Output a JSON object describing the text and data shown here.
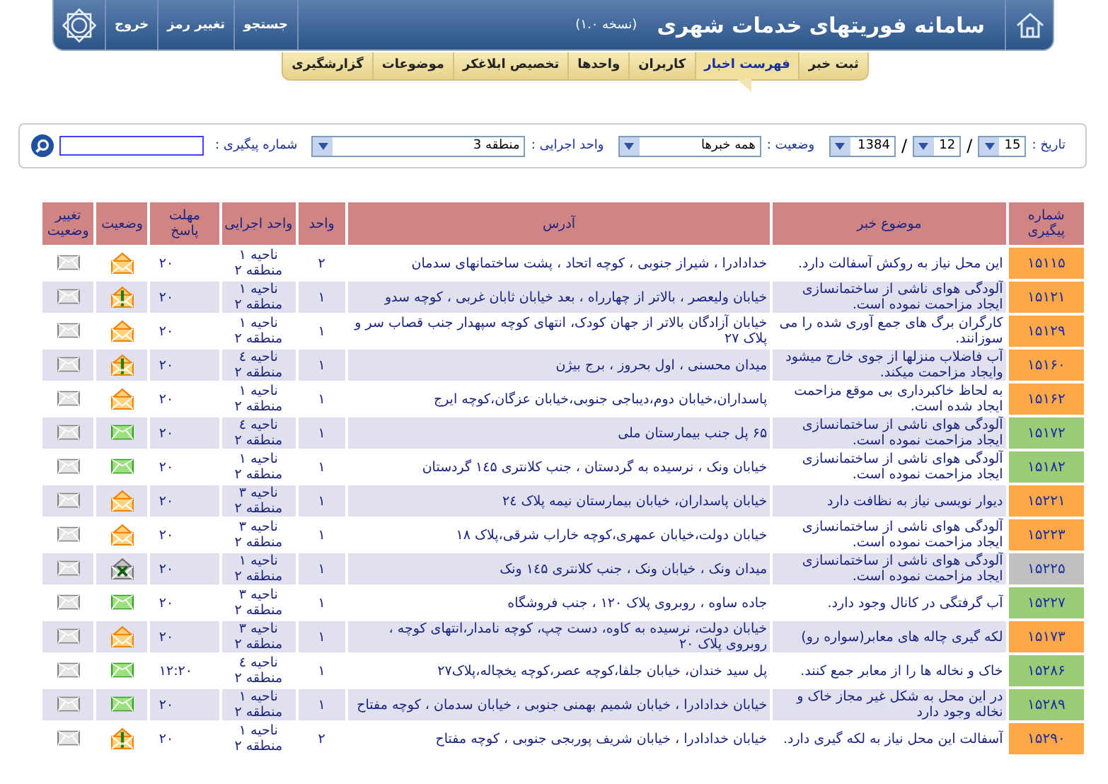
{
  "header": {
    "title": "سامانه فوریتهای خدمات شهری",
    "version": "(نسخه ۱.۰)",
    "links": [
      "جستجو",
      "تغییر رمز",
      "خروج"
    ]
  },
  "tabs": [
    {
      "label": "ثبت خبر",
      "selected": false
    },
    {
      "label": "فهرست اخبار",
      "selected": true
    },
    {
      "label": "کاربران",
      "selected": false
    },
    {
      "label": "واحدها",
      "selected": false
    },
    {
      "label": "تخصیص ابلاغکر",
      "selected": false
    },
    {
      "label": "موضوعات",
      "selected": false
    },
    {
      "label": "گزارشگیری",
      "selected": false
    }
  ],
  "filters": {
    "date_label": "تاریخ :",
    "day": "15",
    "month": "12",
    "year": "1384",
    "separator": "/",
    "status_label": "وضعیت :",
    "status_value": "همه خبرها",
    "unit_label": "واحد اجرایی :",
    "unit_value": "منطقه 3",
    "tracking_label": "شماره پیگیری :"
  },
  "table": {
    "columns": [
      "شماره پیگیری",
      "موضوع خبر",
      "آدرس",
      "واحد",
      "واحد اجرایی",
      "مهلت پاسخ",
      "وضعیت",
      "تغییر وضعیت"
    ],
    "rows": [
      {
        "number": "۱۵۱۱۵",
        "color": "#ffa84a",
        "subject": "این محل نیاز به روکش آسفالت دارد.",
        "address": "خدادادرا ، شیراز جنوبی ، کوچه اتحاد ، پشت ساختمانهای سدمان",
        "unit": "۲",
        "exec": "ناحیه ۱ منطقه ۲",
        "deadline": "۲۰",
        "kind": "open"
      },
      {
        "number": "۱۵۱۲۱",
        "color": "#ffa84a",
        "subject": "آلودگی هوای ناشی از ساختمانسازی ایجاد مزاحمت نموده است.",
        "address": "خیابان ولیعصر ، بالاتر از چهارراه ، بعد خیابان ثابان غربی ، کوچه سدو",
        "unit": "۱",
        "exec": "ناحیه ۱ منطقه ۲",
        "deadline": "۲۰",
        "kind": "alert"
      },
      {
        "number": "۱۵۱۲۹",
        "color": "#ffa84a",
        "subject": "کارگران برگ های جمع آوری شده را می سوزانند.",
        "address": "خیابان آزادگان بالاتر از جهان کودک، انتهای کوچه سپهدار جنب قصاب سر و پلاک ۲۷",
        "unit": "۱",
        "exec": "ناحیه ۱ منطقه ۲",
        "deadline": "۲۰",
        "kind": "open"
      },
      {
        "number": "۱۵۱۶۰",
        "color": "#ffa84a",
        "subject": "آب فاضلاب منزلها از جوی خارج میشود وایجاد مزاحمت میکند.",
        "address": "میدان محسنی ، اول بحروز ، برج بیژن",
        "unit": "۱",
        "exec": "ناحیه ٤ منطقه ۲",
        "deadline": "۲۰",
        "kind": "alert"
      },
      {
        "number": "۱۵۱۶۲",
        "color": "#ffa84a",
        "subject": "به لحاظ خاکبرداری بی موقع مزاحمت ایجاد شده است.",
        "address": "پاسداران،خیابان دوم،دیباجی جنوبی،خیابان عزگان،کوچه ایرج",
        "unit": "۱",
        "exec": "ناحیه ۱ منطقه ۲",
        "deadline": "۲۰",
        "kind": "open"
      },
      {
        "number": "۱۵۱۷۲",
        "color": "#99cc77",
        "subject": "آلودگی هوای ناشی از ساختمانسازی ایجاد مزاحمت نموده است.",
        "address": "۶۵ پل جنب بیمارستان ملی",
        "unit": "۱",
        "exec": "ناحیه ٤ منطقه ۲",
        "deadline": "۲۰",
        "kind": "done"
      },
      {
        "number": "۱۵۱۸۲",
        "color": "#99cc77",
        "subject": "آلودگی هوای ناشی از ساختمانسازی ایجاد مزاحمت نموده است.",
        "address": "خیابان ونک ، نرسیده به گردستان ، جنب کلانتری ۱٤۵ گردستان",
        "unit": "۱",
        "exec": "ناحیه ۱ منطقه ۲",
        "deadline": "۲۰",
        "kind": "done"
      },
      {
        "number": "۱۵۲۲۱",
        "color": "#ffa84a",
        "subject": "دیوار نویسی نیاز به نظافت دارد",
        "address": "خیابان پاسداران، خیابان بیمارستان نیمه پلاک ۲٤",
        "unit": "۱",
        "exec": "ناحیه ۳ منطقه ۲",
        "deadline": "۲۰",
        "kind": "open"
      },
      {
        "number": "۱۵۲۲۳",
        "color": "#ffa84a",
        "subject": "آلودگی هوای ناشی از ساختمانسازی ایجاد مزاحمت نموده است.",
        "address": "خیابان دولت،خیابان عمهری،کوچه خاراب شرقی،پلاک ۱۸",
        "unit": "۱",
        "exec": "ناحیه ۳ منطقه ۲",
        "deadline": "۲۰",
        "kind": "open"
      },
      {
        "number": "۱۵۲۲۵",
        "color": "#c0c0c0",
        "subject": "آلودگی هوای ناشی از ساختمانسازی ایجاد مزاحمت نموده است.",
        "address": "میدان ونک ، خیابان ونک ، جنب کلانتری ۱٤۵ ونک",
        "unit": "۱",
        "exec": "ناحیه ۱ منطقه ۲",
        "deadline": "۲۰",
        "kind": "cancelled"
      },
      {
        "number": "۱۵۲۲۷",
        "color": "#99cc77",
        "subject": "آب گرفتگی در کانال وجود دارد.",
        "address": "جاده ساوه ، روبروی پلاک ۱۲۰ ، جنب فروشگاه",
        "unit": "۱",
        "exec": "ناحیه ۳ منطقه ۲",
        "deadline": "۲۰",
        "kind": "done"
      },
      {
        "number": "۱۵۱۷۳",
        "color": "#ffa84a",
        "subject": "لکه گیری چاله های معابر(سواره رو)",
        "address": "خیابان دولت، نرسیده به کاوه، دست چپ، کوچه نامدار،انتهای کوچه ، روبروی پلاک ۲۰",
        "unit": "۱",
        "exec": "ناحیه ۳ منطقه ۲",
        "deadline": "۲۰",
        "kind": "open"
      },
      {
        "number": "۱۵۲۸۶",
        "color": "#99cc77",
        "subject": "خاک و نخاله ها را از معابر جمع کنند.",
        "address": "پل سید خندان، خیابان جلفا،کوچه عصر،کوچه یخچاله،پلاک۲۷",
        "unit": "۱",
        "exec": "ناحیه ٤ منطقه ۲",
        "deadline": "۱۲:۲۰",
        "kind": "done"
      },
      {
        "number": "۱۵۲۸۹",
        "color": "#99cc77",
        "subject": "در این محل به شکل غیر مجاز خاک و نخاله وجود دارد",
        "address": "خیابان خدادادرا ، خیابان شمیم بهمنی جنوبی ، خیابان سدمان ، کوچه مفتاح",
        "unit": "۱",
        "exec": "ناحیه ۱ منطقه ۲",
        "deadline": "۲۰",
        "kind": "done"
      },
      {
        "number": "۱۵۲۹۰",
        "color": "#ffa84a",
        "subject": "آسفالت این محل نیاز به لکه گیری دارد.",
        "address": "خیابان خدادادرا ، خیابان شریف پوربجی جنوبی ، کوچه مفتاح",
        "unit": "۲",
        "exec": "ناحیه ۱ منطقه ۲",
        "deadline": "۲۰",
        "kind": "alert"
      }
    ]
  }
}
